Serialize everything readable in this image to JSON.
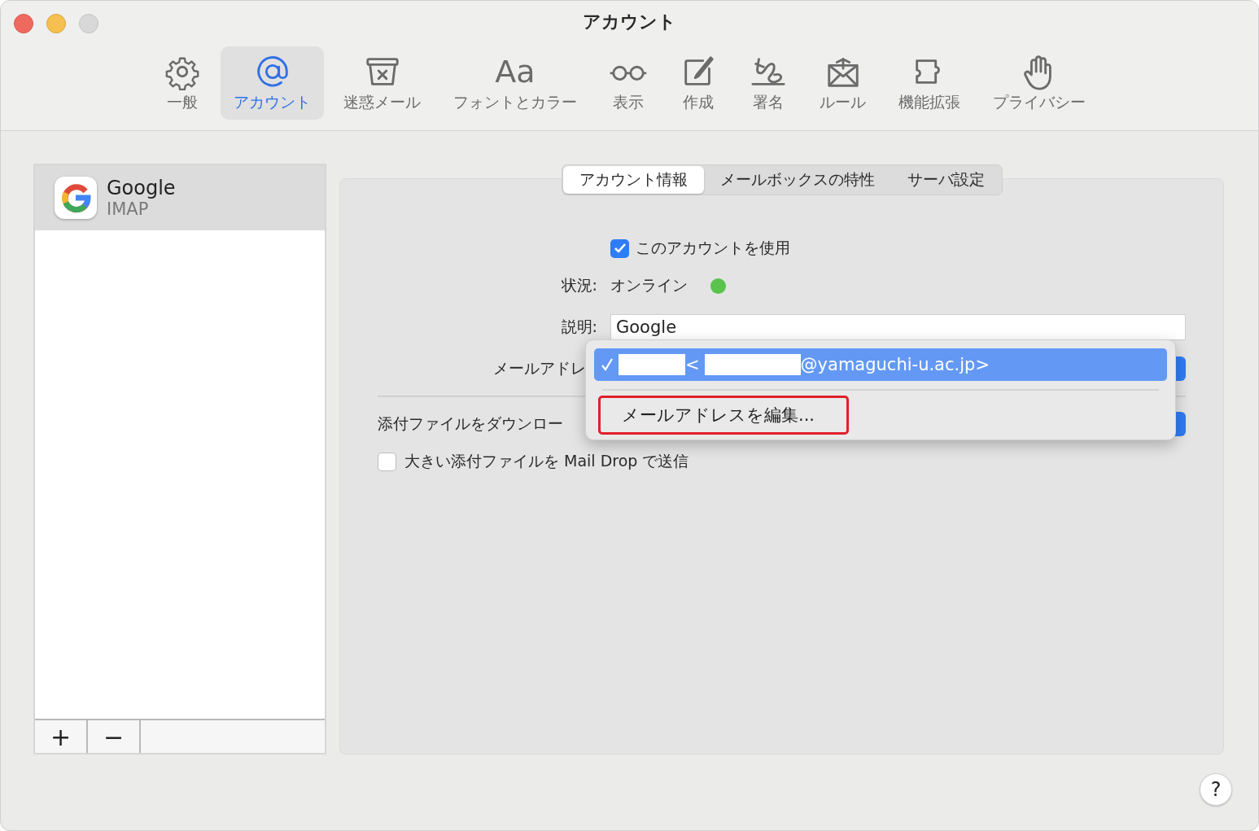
{
  "window": {
    "title": "アカウント"
  },
  "toolbar": [
    {
      "kind": "gear",
      "label": "一般",
      "selected": false
    },
    {
      "kind": "at",
      "label": "アカウント",
      "selected": true
    },
    {
      "kind": "junk",
      "label": "迷惑メール",
      "selected": false
    },
    {
      "kind": "fonts",
      "glyph": "Aa",
      "label": "フォントとカラー",
      "selected": false
    },
    {
      "kind": "glasses",
      "label": "表示",
      "selected": false
    },
    {
      "kind": "compose",
      "label": "作成",
      "selected": false
    },
    {
      "kind": "signature",
      "label": "署名",
      "selected": false
    },
    {
      "kind": "rules",
      "label": "ルール",
      "selected": false
    },
    {
      "kind": "extension",
      "label": "機能拡張",
      "selected": false
    },
    {
      "kind": "hand",
      "label": "プライバシー",
      "selected": false
    }
  ],
  "accounts": [
    {
      "name": "Google",
      "type": "IMAP",
      "selected": true
    }
  ],
  "account_buttons": [
    "+",
    "−"
  ],
  "tabs": [
    {
      "label": "アカウント情報",
      "selected": true
    },
    {
      "label": "メールボックスの特性",
      "selected": false
    },
    {
      "label": "サーバ設定",
      "selected": false
    }
  ],
  "form": {
    "enable": {
      "label": "このアカウントを使用",
      "checked": true
    },
    "status": {
      "label": "状況:",
      "value": "オンライン",
      "color": "#5ac34e"
    },
    "description": {
      "label": "説明:",
      "value": "Google"
    },
    "email": {
      "label": "メールアドレ"
    },
    "download": {
      "label": "添付ファイルをダウンロー"
    },
    "mail_drop": {
      "label": "大きい添付ファイルを Mail Drop で送信",
      "checked": false
    }
  },
  "menu": [
    {
      "checked": true,
      "selected": true,
      "outlined": false,
      "parts": [
        {
          "kind": "redacted"
        },
        {
          "kind": "text",
          "text": "<"
        },
        {
          "kind": "redacted"
        },
        {
          "kind": "text",
          "text": "@yamaguchi-u.ac.jp>"
        }
      ]
    },
    {
      "checked": false,
      "selected": false,
      "outlined": true,
      "parts": [
        {
          "kind": "text",
          "text": "メールアドレスを編集..."
        }
      ]
    }
  ],
  "help": "?"
}
